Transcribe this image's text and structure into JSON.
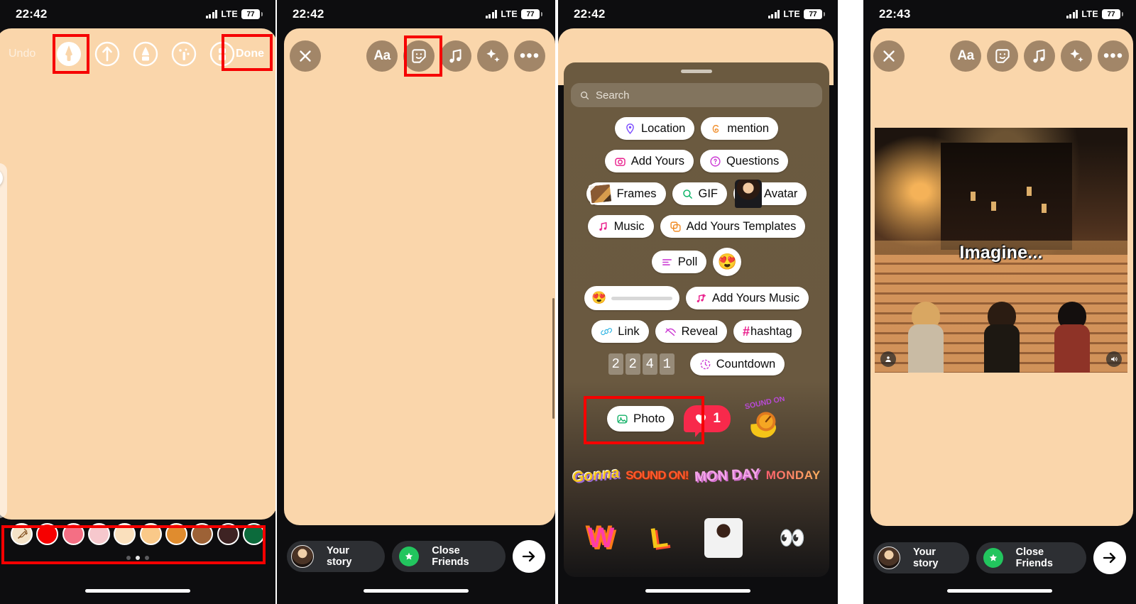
{
  "panels": [
    {
      "id": "draw-editor",
      "status": {
        "time": "22:42",
        "network": "LTE",
        "battery": "77"
      },
      "toolbar": {
        "undo_label": "Undo",
        "done_label": "Done",
        "tools": [
          {
            "name": "pen-tool",
            "selected": true
          },
          {
            "name": "arrow-tool",
            "selected": false
          },
          {
            "name": "marker-tool",
            "selected": false
          },
          {
            "name": "glitter-tool",
            "selected": false
          },
          {
            "name": "eraser-tool",
            "selected": false
          }
        ]
      },
      "palette": {
        "eyedropper_label": "eyedropper",
        "colors": [
          "#f4e3c8",
          "#f60000",
          "#f46f84",
          "#f6c8cd",
          "#fae0bd",
          "#fac989",
          "#e08c2e",
          "#9d6236",
          "#3e2323",
          "#0c6b3c"
        ],
        "page_dots": 3,
        "active_dot": 1
      }
    },
    {
      "id": "story-composer-empty",
      "status": {
        "time": "22:42",
        "network": "LTE",
        "battery": "77"
      },
      "toolbar": {
        "close_label": "close",
        "text_label": "Aa",
        "sticker_label": "sticker",
        "music_label": "music",
        "effects_label": "effects",
        "more_label": "more"
      },
      "share": {
        "your_story": "Your story",
        "close_friends": "Close Friends",
        "send_label": "send"
      }
    },
    {
      "id": "sticker-tray",
      "status": {
        "time": "22:42",
        "network": "LTE",
        "battery": "77"
      },
      "search": {
        "placeholder": "Search",
        "icon": "search-icon"
      },
      "sticker_rows": [
        [
          {
            "label": "Location",
            "icon": "location-pin-icon",
            "color": "#7c4dff"
          },
          {
            "label": "mention",
            "icon": "threads-icon",
            "color": "#f08a24"
          }
        ],
        [
          {
            "label": "Add Yours",
            "icon": "camera-icon",
            "color": "#e91e8c"
          },
          {
            "label": "Questions",
            "icon": "question-bubble-icon",
            "color": "#cc3bd4"
          }
        ],
        [
          {
            "label": "Frames",
            "icon": "photo-stack-icon",
            "color": "#8a5a33"
          },
          {
            "label": "GIF",
            "icon": "gif-search-icon",
            "color": "#00b060"
          },
          {
            "label": "Avatar",
            "icon": "avatar-icon",
            "color": "#2b1a12"
          }
        ],
        [
          {
            "label": "Music",
            "icon": "music-note-icon",
            "color": "#e91e8c"
          },
          {
            "label": "Add Yours Templates",
            "icon": "templates-icon",
            "color": "#f08a24"
          }
        ],
        [
          {
            "label": "Poll",
            "icon": "poll-icon",
            "color": "#cc3bd4"
          },
          {
            "label": "",
            "icon": "emoji-heart-eyes",
            "emoji": "😍"
          }
        ],
        [
          {
            "label": "",
            "icon": "emoji-slider",
            "emoji": "😍"
          },
          {
            "label": "Add Yours Music",
            "icon": "music-plus-icon",
            "color": "#e91e8c"
          }
        ],
        [
          {
            "label": "Link",
            "icon": "link-icon",
            "color": "#2bb3e3"
          },
          {
            "label": "Reveal",
            "icon": "reveal-icon",
            "color": "#cc3bd4"
          },
          {
            "label": "hashtag",
            "icon": "hashtag-icon",
            "prefix": "#",
            "color": "#e91e8c"
          }
        ],
        [
          {
            "label": "countdown-digits",
            "digits": [
              "2",
              "2",
              "4",
              "1"
            ]
          },
          {
            "label": "Countdown",
            "icon": "countdown-icon",
            "color": "#cc3bd4"
          }
        ]
      ],
      "highlighted_sticker": {
        "label": "Photo",
        "icon": "photo-icon",
        "color": "#17b26a"
      },
      "like_sticker": {
        "count": "1",
        "icon": "heart-icon",
        "color": "#f8294b"
      },
      "sound_on_sticker": {
        "label": "SOUND ON"
      },
      "graffiti_row_1": [
        "Gonna",
        "SOUND ON!",
        "MON DAY",
        "MONDAY"
      ],
      "graffiti_row_2": [
        "W",
        "L",
        "person-ok-sticker",
        "eyes-sticker"
      ]
    },
    {
      "id": "story-composer-photo",
      "status": {
        "time": "22:43",
        "network": "LTE",
        "battery": "77"
      },
      "toolbar": {
        "close_label": "close",
        "text_label": "Aa",
        "sticker_label": "sticker",
        "music_label": "music",
        "effects_label": "effects",
        "more_label": "more"
      },
      "photo": {
        "caption": "Imagine...",
        "tag_badge": "person-tag-icon",
        "sound_badge": "sound-on-icon"
      },
      "share": {
        "your_story": "Your story",
        "close_friends": "Close Friends",
        "send_label": "send"
      }
    }
  ],
  "annotations": {
    "highlight_color": "#f60000"
  }
}
